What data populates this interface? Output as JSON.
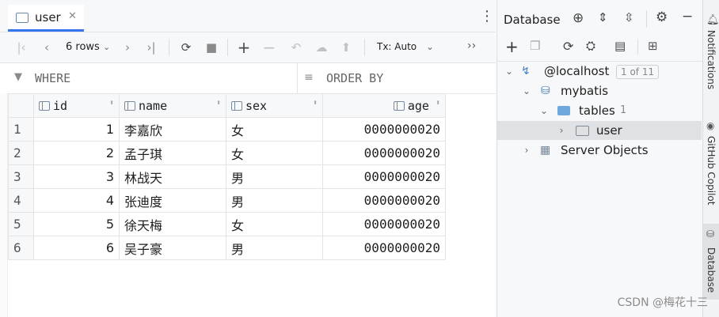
{
  "editor": {
    "tab_label": "user",
    "close_glyph": "✕",
    "kebab_glyph": "⋮"
  },
  "toolbar": {
    "rows_label": "6 rows",
    "tx_label": "Tx: Auto",
    "more_glyph": "››"
  },
  "filter": {
    "where_label": "WHERE",
    "order_label": "ORDER BY"
  },
  "table": {
    "columns": [
      "id",
      "name",
      "sex",
      "age"
    ],
    "rows": [
      {
        "num": "1",
        "id": "1",
        "name": "李嘉欣",
        "sex": "女",
        "age": "0000000020"
      },
      {
        "num": "2",
        "id": "2",
        "name": "孟子琪",
        "sex": "女",
        "age": "0000000020"
      },
      {
        "num": "3",
        "id": "3",
        "name": "林战天",
        "sex": "男",
        "age": "0000000020"
      },
      {
        "num": "4",
        "id": "4",
        "name": "张迪度",
        "sex": "男",
        "age": "0000000020"
      },
      {
        "num": "5",
        "id": "5",
        "name": "徐天梅",
        "sex": "女",
        "age": "0000000020"
      },
      {
        "num": "6",
        "id": "6",
        "name": "吴子豪",
        "sex": "男",
        "age": "0000000020"
      }
    ]
  },
  "db": {
    "title": "Database",
    "host": "@localhost",
    "host_badge": "1 of 11",
    "schema": "mybatis",
    "tables_label": "tables",
    "tables_count": "1",
    "table_item": "user",
    "server_objects": "Server Objects"
  },
  "strip": {
    "notifications": "Notifications",
    "copilot": "GitHub Copilot",
    "database": "Database"
  },
  "watermark": "CSDN @梅花十三",
  "colors": {
    "accent": "#3574f0",
    "selection": "#dfe1e5"
  }
}
